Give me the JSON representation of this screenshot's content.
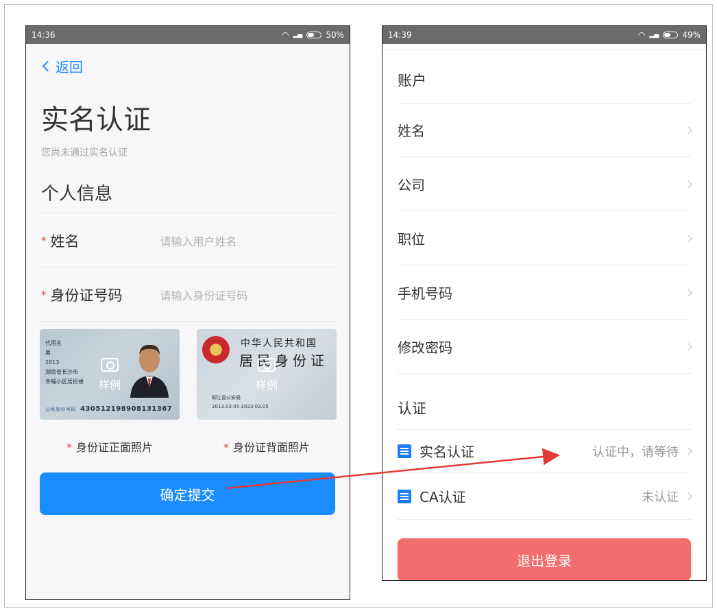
{
  "left_phone": {
    "status_time": "14:36",
    "status_battery": "50%",
    "back_label": "返回",
    "title": "实名认证",
    "subtitle": "您尚未通过实名认证",
    "section_title": "个人信息",
    "fields": [
      {
        "label": "姓名",
        "placeholder": "请输入用户姓名"
      },
      {
        "label": "身份证号码",
        "placeholder": "请输入身份证号码"
      }
    ],
    "card_front": {
      "lines": [
        "代用名",
        "男",
        "2013",
        "湖南省长沙市",
        "幸福小区居民楼"
      ],
      "number_label": "公民身份号码",
      "number": "430512198908131367",
      "sample": "样例",
      "caption": "身份证正面照片"
    },
    "card_back": {
      "title1": "中华人民共和国",
      "title2": "居民身份证",
      "authority": "柳江县公安局",
      "validity": "2013.03.05-2023.03.05",
      "sample": "样例",
      "caption": "身份证背面照片"
    },
    "submit_label": "确定提交",
    "accent": "#1a8cff"
  },
  "right_phone": {
    "status_time": "14:39",
    "status_battery": "49%",
    "account_section": "账户",
    "account_rows": [
      {
        "label": "姓名"
      },
      {
        "label": "公司"
      },
      {
        "label": "职位"
      },
      {
        "label": "手机号码"
      },
      {
        "label": "修改密码"
      }
    ],
    "auth_section": "认证",
    "auth_rows": [
      {
        "label": "实名认证",
        "value": "认证中，请等待"
      },
      {
        "label": "CA认证",
        "value": "未认证"
      }
    ],
    "logout_label": "退出登录",
    "logout_color": "#f26d6d"
  },
  "annotation": {
    "arrow_color": "#e53935"
  }
}
